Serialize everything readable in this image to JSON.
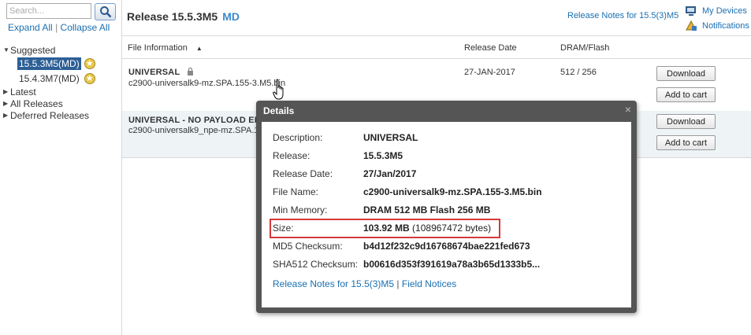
{
  "sidebar": {
    "search_placeholder": "Search...",
    "expand_all": "Expand All",
    "divider": "|",
    "collapse_all": "Collapse All",
    "tree": [
      {
        "label": "Suggested",
        "expanded": true
      },
      {
        "label": "Latest",
        "expanded": false
      },
      {
        "label": "All Releases",
        "expanded": false
      },
      {
        "label": "Deferred Releases",
        "expanded": false
      }
    ],
    "suggested_items": [
      {
        "label": "15.5.3M5(MD)",
        "selected": true
      },
      {
        "label": "15.4.3M7(MD)",
        "selected": false
      }
    ]
  },
  "header": {
    "release_title": "Release 15.5.3M5",
    "release_tag": "MD",
    "release_notes_link": "Release Notes for 15.5(3)M5",
    "my_devices": "My Devices",
    "notifications": "Notifications"
  },
  "table": {
    "columns": {
      "file_info": "File Information",
      "release_date": "Release Date",
      "dram_flash": "DRAM/Flash"
    },
    "rows": [
      {
        "title": "UNIVERSAL",
        "file": "c2900-universalk9-mz.SPA.155-3.M5.bin",
        "date": "27-JAN-2017",
        "dram_flash": "512 / 256",
        "download": "Download",
        "cart": "Add to cart"
      },
      {
        "title": "UNIVERSAL - NO PAYLOAD EN",
        "file": "c2900-universalk9_npe-mz.SPA.1",
        "download": "Download",
        "cart": "Add to cart"
      }
    ]
  },
  "details": {
    "title": "Details",
    "close": "×",
    "fields": [
      {
        "label": "Description:",
        "value": "UNIVERSAL"
      },
      {
        "label": "Release:",
        "value": "15.5.3M5"
      },
      {
        "label": "Release Date:",
        "value": "27/Jan/2017"
      },
      {
        "label": "File Name:",
        "value": "c2900-universalk9-mz.SPA.155-3.M5.bin"
      },
      {
        "label": "Min Memory:",
        "value": "DRAM 512 MB Flash 256 MB"
      },
      {
        "label": "Size:",
        "value": "103.92 MB",
        "value_extra": "(108967472 bytes)"
      },
      {
        "label": "MD5 Checksum:",
        "value": "b4d12f232c9d16768674bae221fed673"
      },
      {
        "label": "SHA512 Checksum:",
        "value": "b00616d353f391619a78a3b65d1333b5..."
      }
    ],
    "release_notes_link": "Release Notes for 15.5(3)M5",
    "divider": "|",
    "field_notices_link": "Field Notices"
  }
}
